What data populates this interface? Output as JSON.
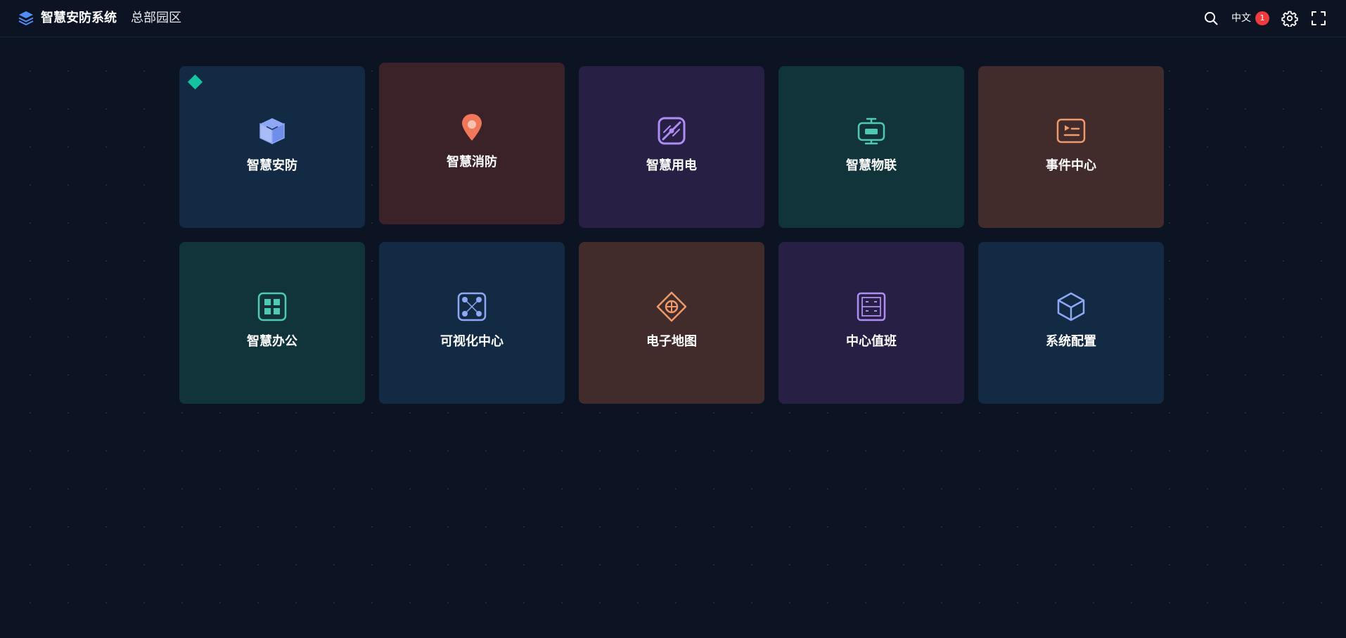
{
  "header": {
    "brand_icon": "layers-icon",
    "title": "智慧安防系统",
    "site": "总部园区",
    "language": "中文",
    "notification_count": "1",
    "icons": [
      "search-icon",
      "gear-icon",
      "fullscreen-icon"
    ]
  },
  "modules": [
    {
      "label": "智慧安防",
      "icon": "cube-icon",
      "color": "#132a44",
      "icon_color": "#8fa8f5",
      "active": true
    },
    {
      "label": "智慧消防",
      "icon": "fire-pin-icon",
      "color": "#3b2229",
      "icon_color": "#f0775a"
    },
    {
      "label": "智慧用电",
      "icon": "power-line-icon",
      "color": "#271f44",
      "icon_color": "#b08cf5"
    },
    {
      "label": "智慧物联",
      "icon": "iot-device-icon",
      "color": "#11343b",
      "icon_color": "#4fc9b4"
    },
    {
      "label": "事件中心",
      "icon": "event-play-icon",
      "color": "#412b2b",
      "icon_color": "#f0996a"
    },
    {
      "label": "智慧办公",
      "icon": "office-grid-icon",
      "color": "#11343b",
      "icon_color": "#4fc9b4"
    },
    {
      "label": "可视化中心",
      "icon": "visual-nodes-icon",
      "color": "#132a44",
      "icon_color": "#8fa8f5"
    },
    {
      "label": "电子地图",
      "icon": "map-diamond-icon",
      "color": "#412b2b",
      "icon_color": "#f0996a"
    },
    {
      "label": "中心值班",
      "icon": "duty-panel-icon",
      "color": "#271f44",
      "icon_color": "#b08cf5"
    },
    {
      "label": "系统配置",
      "icon": "config-cube-icon",
      "color": "#132a44",
      "icon_color": "#8fa8f5"
    }
  ]
}
